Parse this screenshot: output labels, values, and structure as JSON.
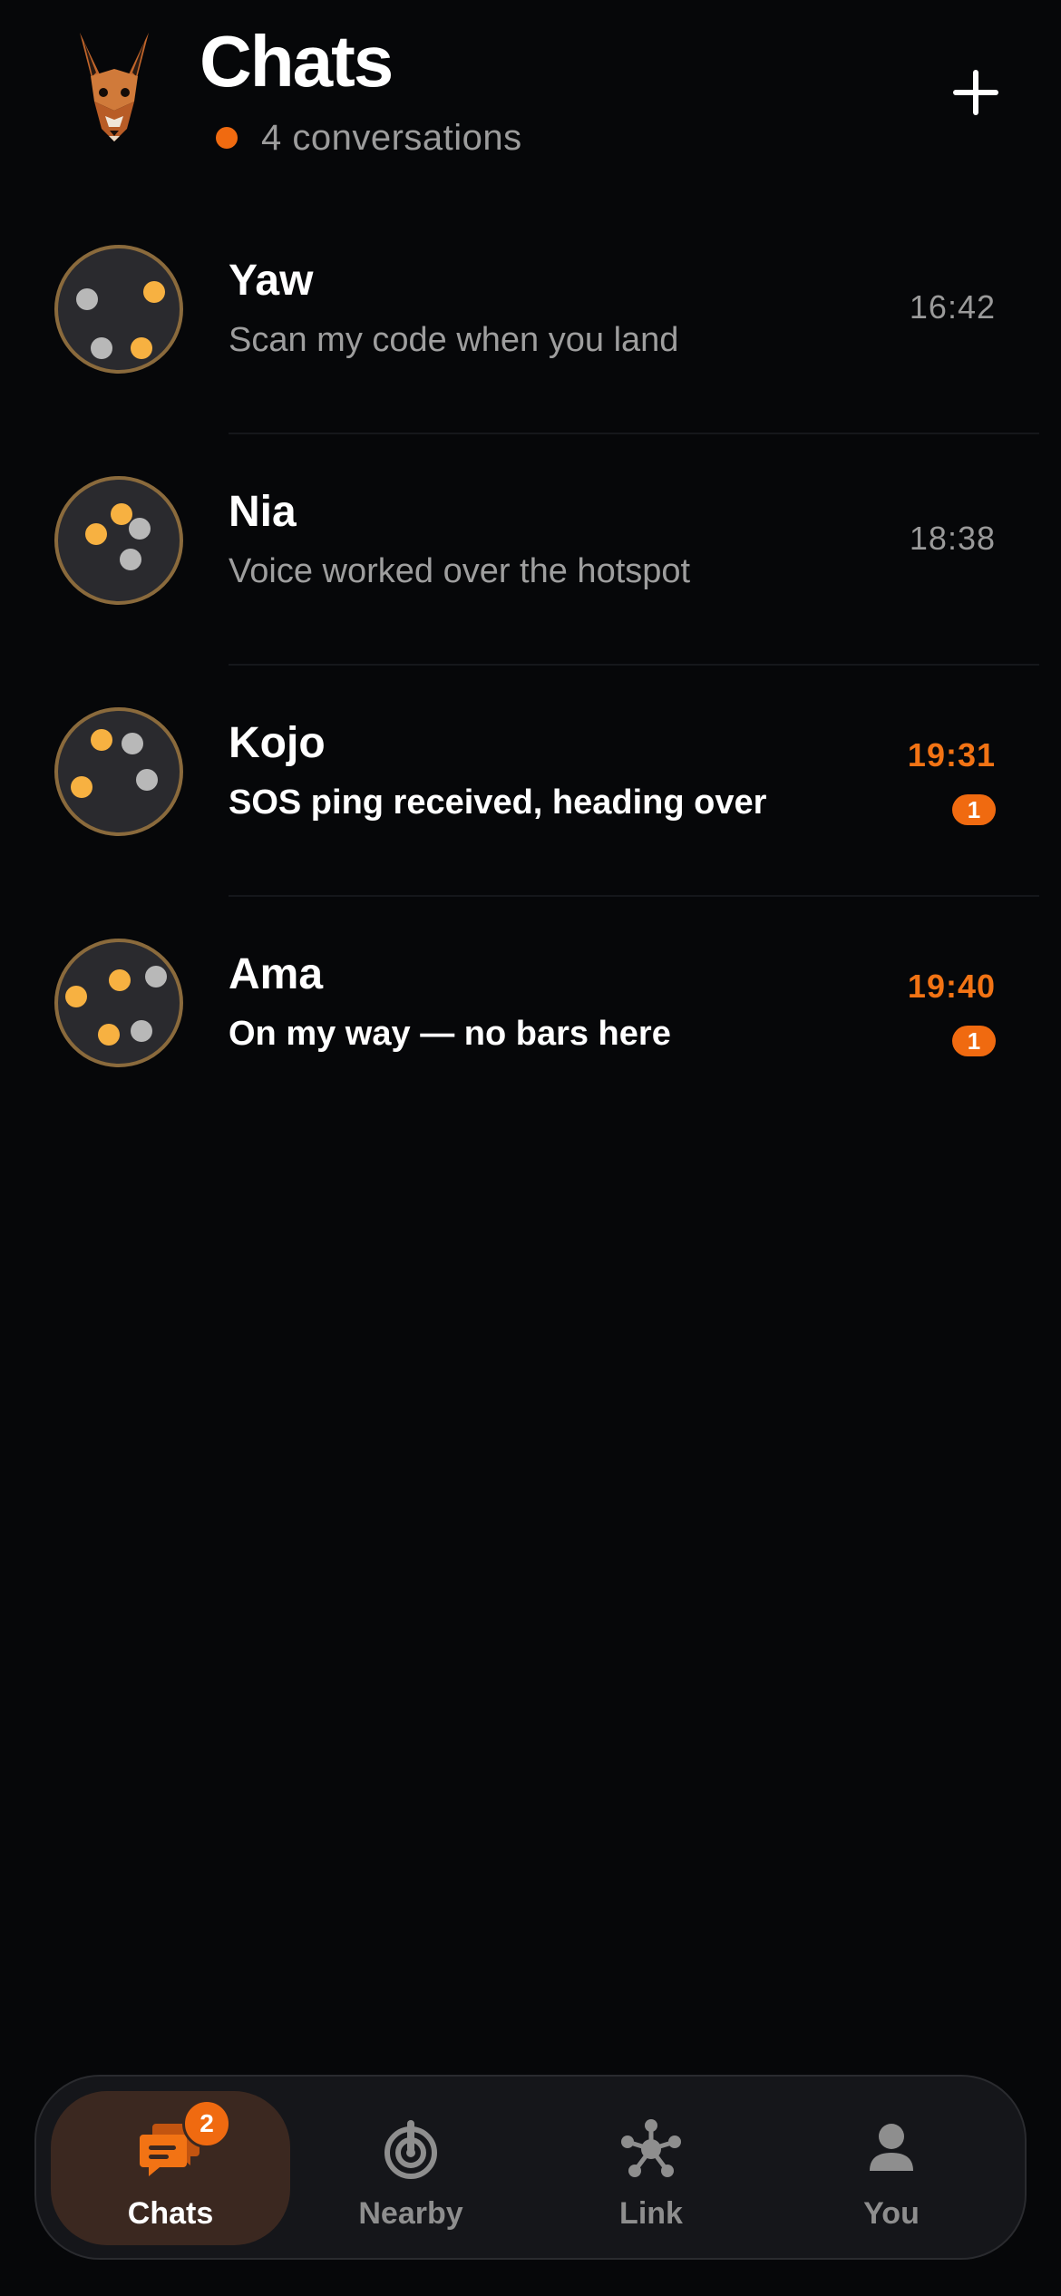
{
  "header": {
    "title": "Chats",
    "subtitle": "4 conversations",
    "status_color": "#f06a10",
    "logo_icon": "kangaroo-logo-icon",
    "new_chat_icon": "plus-icon"
  },
  "chats": [
    {
      "name": "Yaw",
      "preview": "Scan my code when you land",
      "time": "16:42",
      "unread": false,
      "unread_count": ""
    },
    {
      "name": "Nia",
      "preview": "Voice worked over the hotspot",
      "time": "18:38",
      "unread": false,
      "unread_count": ""
    },
    {
      "name": "Kojo",
      "preview": "SOS ping received, heading over",
      "time": "19:31",
      "unread": true,
      "unread_count": "1"
    },
    {
      "name": "Ama",
      "preview": "On my way — no bars here",
      "time": "19:40",
      "unread": true,
      "unread_count": "1"
    }
  ],
  "tabs": [
    {
      "label": "Chats",
      "icon": "chat-bubbles-icon",
      "active": true,
      "badge": "2"
    },
    {
      "label": "Nearby",
      "icon": "radar-icon",
      "active": false,
      "badge": ""
    },
    {
      "label": "Link",
      "icon": "mesh-network-icon",
      "active": false,
      "badge": ""
    },
    {
      "label": "You",
      "icon": "person-icon",
      "active": false,
      "badge": ""
    }
  ],
  "colors": {
    "accent": "#f06a10",
    "dot_orange": "#f7b141",
    "dot_grey": "#b8b8b8",
    "avatar_ring": "#8a6a3c",
    "background": "#060709"
  }
}
